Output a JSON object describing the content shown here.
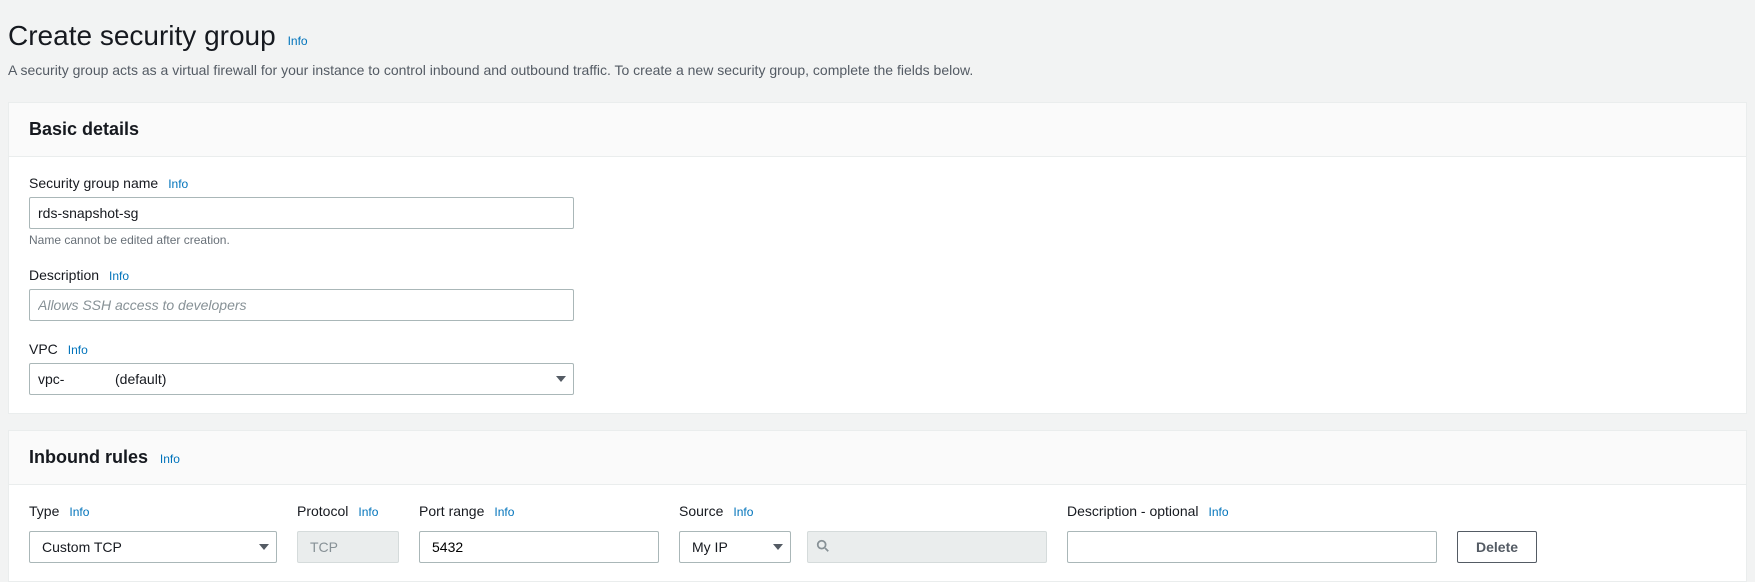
{
  "header": {
    "title": "Create security group",
    "info": "Info",
    "description": "A security group acts as a virtual firewall for your instance to control inbound and outbound traffic. To create a new security group, complete the fields below."
  },
  "basic": {
    "panel_title": "Basic details",
    "name_label": "Security group name",
    "name_info": "Info",
    "name_value": "rds-snapshot-sg",
    "name_helper": "Name cannot be edited after creation.",
    "desc_label": "Description",
    "desc_info": "Info",
    "desc_placeholder": "Allows SSH access to developers",
    "desc_value": "",
    "vpc_label": "VPC",
    "vpc_info": "Info",
    "vpc_value": "vpc-             (default)"
  },
  "inbound": {
    "panel_title": "Inbound rules",
    "panel_info": "Info",
    "columns": {
      "type": "Type",
      "type_info": "Info",
      "protocol": "Protocol",
      "protocol_info": "Info",
      "port": "Port range",
      "port_info": "Info",
      "source": "Source",
      "source_info": "Info",
      "desc": "Description - optional",
      "desc_info": "Info"
    },
    "row": {
      "type": "Custom TCP",
      "protocol": "TCP",
      "port": "5432",
      "source_mode": "My IP",
      "source_search": "",
      "desc": "",
      "delete": "Delete"
    }
  }
}
